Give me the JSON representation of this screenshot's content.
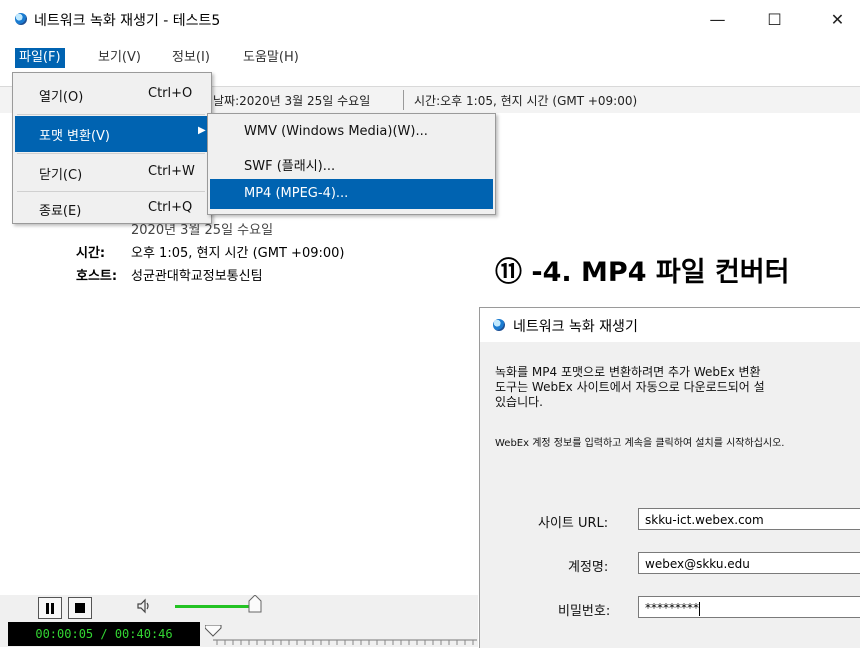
{
  "window": {
    "title": "네트워크 녹화 재생기 - 테스트5",
    "controls": {
      "minimize": "—",
      "maximize": "☐",
      "close": "✕"
    }
  },
  "menubar": {
    "file": "파일(F)",
    "view": "보기(V)",
    "info": "정보(I)",
    "help": "도움말(H)"
  },
  "infobar": {
    "date": "날짜:2020년 3월 25일 수요일",
    "time": "시간:오후 1:05, 현지 시간 (GMT +09:00)"
  },
  "details": {
    "date_row": "2020년 3월 25일 수요일",
    "time_label": "시간:",
    "time_value": "오후 1:05, 현지 시간 (GMT +09:00)",
    "host_label": "호스트:",
    "host_value": "성균관대학교정보통신팀"
  },
  "file_menu": {
    "open": {
      "label": "열기(O)",
      "shortcut": "Ctrl+O"
    },
    "convert": {
      "label": "포맷 변환(V)",
      "arrow": "▶"
    },
    "close": {
      "label": "닫기(C)",
      "shortcut": "Ctrl+W"
    },
    "exit": {
      "label": "종료(E)",
      "shortcut": "Ctrl+Q"
    }
  },
  "convert_submenu": {
    "wmv": "WMV (Windows Media)(W)...",
    "swf": "SWF (플래시)...",
    "mp4": "MP4 (MPEG-4)..."
  },
  "player": {
    "time": "00:00:05 / 00:40:46",
    "volume_level": 0.9,
    "progress": 0.002
  },
  "heading": "⑪ -4. MP4 파일 컨버터",
  "dialog": {
    "title": "네트워크 녹화 재생기",
    "desc_line1": "녹화를 MP4 포맷으로 변환하려면 추가 WebEx 변환",
    "desc_line2": "도구는 WebEx 사이트에서 자동으로 다운로드되어 설",
    "desc_line3": "있습니다.",
    "instruction": "WebEx 계정 정보를 입력하고 계속을 클릭하여 설치를 시작하십시오.",
    "site_label": "사이트 URL:",
    "site_value": "skku-ict.webex.com",
    "account_label": "계정명:",
    "account_value": "webex@skku.edu",
    "password_label": "비밀번호:",
    "password_value": "*********"
  },
  "colors": {
    "menu_highlight": "#0063b1",
    "time_text": "#33d633",
    "volume": "#23c323"
  }
}
